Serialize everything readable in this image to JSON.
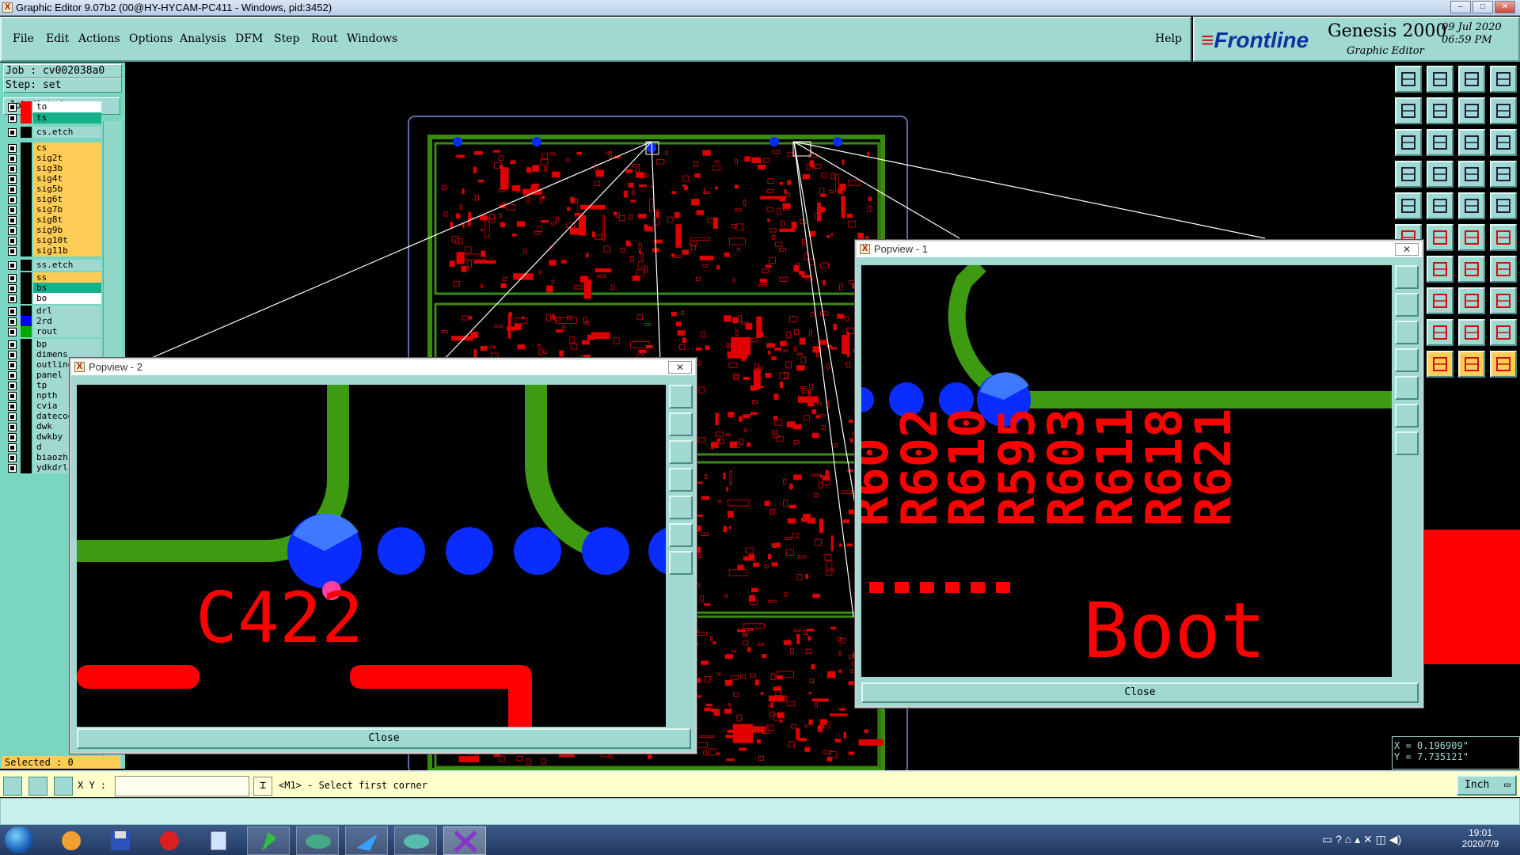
{
  "window": {
    "title": "Graphic Editor 9.07b2 (00@HY-HYCAM-PC411 - Windows, pid:3452)",
    "minimize": "–",
    "maximize": "□",
    "close": "✕"
  },
  "menu": {
    "items": [
      "File",
      "Edit",
      "Actions",
      "Options",
      "Analysis",
      "DFM",
      "Step",
      "Rout",
      "Windows"
    ],
    "help": "Help"
  },
  "branding": {
    "frontline": "Frontline",
    "genesis": "Genesis 2000",
    "subtitle": "Graphic Editor",
    "date": "09 Jul 2020",
    "time": "06:59 PM"
  },
  "job": {
    "job_line": "Job : cv002038a0",
    "step_line": "Step: set",
    "matrix_button": "Job Matrix ..."
  },
  "layers": [
    {
      "name": "to",
      "swatch": "#ff0000",
      "bg": "#ffffff"
    },
    {
      "name": "ts",
      "swatch": "#ff0000",
      "bg": "#16b08a"
    },
    {
      "name": "cs.etch",
      "swatch": "#000000",
      "bg": "#a0d8d2"
    },
    {
      "name": "cs",
      "swatch": "#000000",
      "bg": "#ffcc55"
    },
    {
      "name": "sig2t",
      "swatch": "#000000",
      "bg": "#ffcc55"
    },
    {
      "name": "sig3b",
      "swatch": "#000000",
      "bg": "#ffcc55"
    },
    {
      "name": "sig4t",
      "swatch": "#000000",
      "bg": "#ffcc55"
    },
    {
      "name": "sig5b",
      "swatch": "#000000",
      "bg": "#ffcc55"
    },
    {
      "name": "sig6t",
      "swatch": "#000000",
      "bg": "#ffcc55"
    },
    {
      "name": "sig7b",
      "swatch": "#000000",
      "bg": "#ffcc55"
    },
    {
      "name": "sig8t",
      "swatch": "#000000",
      "bg": "#ffcc55"
    },
    {
      "name": "sig9b",
      "swatch": "#000000",
      "bg": "#ffcc55"
    },
    {
      "name": "sig10t",
      "swatch": "#000000",
      "bg": "#ffcc55"
    },
    {
      "name": "sig11b",
      "swatch": "#000000",
      "bg": "#ffcc55"
    },
    {
      "name": "ss.etch",
      "swatch": "#000000",
      "bg": "#a0d8d2"
    },
    {
      "name": "ss",
      "swatch": "#000000",
      "bg": "#ffcc55"
    },
    {
      "name": "bs",
      "swatch": "#000000",
      "bg": "#16b08a"
    },
    {
      "name": "bo",
      "swatch": "#000000",
      "bg": "#ffffff"
    },
    {
      "name": "drl",
      "swatch": "#000000",
      "bg": "#a0d8d2"
    },
    {
      "name": "2rd",
      "swatch": "#0000ff",
      "bg": "#a0d8d2"
    },
    {
      "name": "rout",
      "swatch": "#00aa00",
      "bg": "#a0d8d2"
    },
    {
      "name": "bp",
      "swatch": "#000000",
      "bg": "#a0d8d2"
    },
    {
      "name": "dimens",
      "swatch": "#000000",
      "bg": "#a0d8d2"
    },
    {
      "name": "outline",
      "swatch": "#000000",
      "bg": "#a0d8d2"
    },
    {
      "name": "panel",
      "swatch": "#000000",
      "bg": "#a0d8d2"
    },
    {
      "name": "tp",
      "swatch": "#000000",
      "bg": "#a0d8d2"
    },
    {
      "name": "npth",
      "swatch": "#000000",
      "bg": "#a0d8d2"
    },
    {
      "name": "cvia",
      "swatch": "#000000",
      "bg": "#a0d8d2"
    },
    {
      "name": "datecode",
      "swatch": "#000000",
      "bg": "#a0d8d2"
    },
    {
      "name": "dwk",
      "swatch": "#000000",
      "bg": "#a0d8d2"
    },
    {
      "name": "dwkby",
      "swatch": "#000000",
      "bg": "#a0d8d2"
    },
    {
      "name": "d",
      "swatch": "#000000",
      "bg": "#a0d8d2"
    },
    {
      "name": "biaozhi",
      "swatch": "#000000",
      "bg": "#a0d8d2"
    },
    {
      "name": "ydkdrl",
      "swatch": "#000000",
      "bg": "#a0d8d2"
    }
  ],
  "status": {
    "selected": "Selected : 0",
    "xy_label": "X Y :",
    "prompt": "<M1> - Select first corner",
    "units": "Inch",
    "coord_x": "X = 0.196909\"",
    "coord_y": "Y = 7.735121\""
  },
  "popview1": {
    "title": "Popview - 1",
    "close_label": "Close",
    "refdes": [
      "R602",
      "R610",
      "R595",
      "R603",
      "R611",
      "R618",
      "R621"
    ],
    "silk_text": "Boot",
    "partial": "R60"
  },
  "popview2": {
    "title": "Popview - 2",
    "close_label": "Close",
    "silk_text": "C422"
  },
  "taskbar": {
    "time": "19:01",
    "date": "2020/7/9"
  },
  "colors": {
    "panel": "#a0d8d2",
    "trace_green": "#3e9a10",
    "pad_blue": "#0a2cff",
    "silk_red": "#ff0000",
    "highlight": "#ffcc55"
  }
}
